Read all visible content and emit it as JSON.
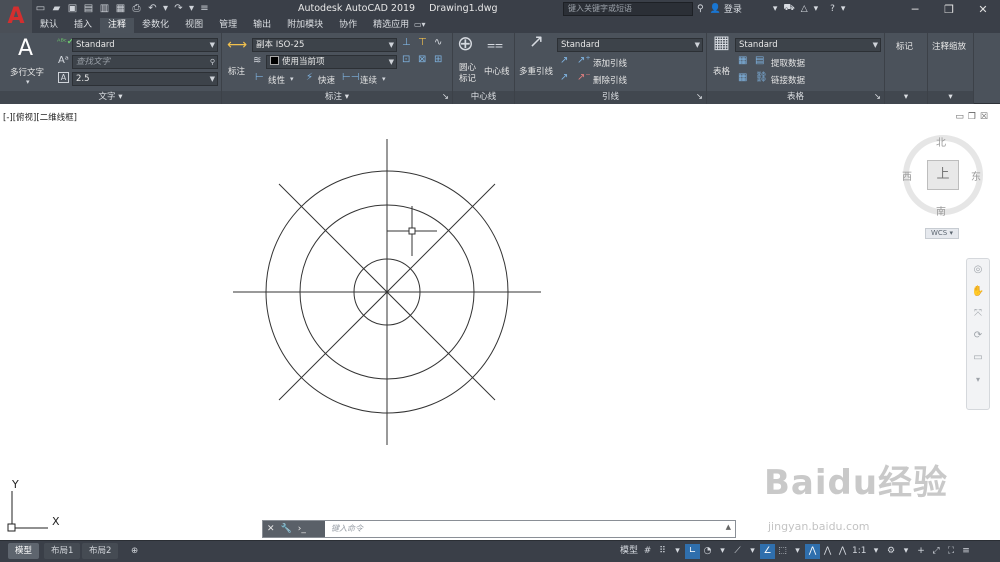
{
  "titlebar": {
    "app_name": "Autodesk AutoCAD 2019",
    "file_name": "Drawing1.dwg",
    "search_placeholder": "键入关键字或短语",
    "login_label": "登录",
    "help_label": "?"
  },
  "tabs": [
    "默认",
    "插入",
    "注释",
    "参数化",
    "视图",
    "管理",
    "输出",
    "附加模块",
    "协作",
    "精选应用"
  ],
  "active_tab": "注释",
  "ribbon": {
    "text_panel": {
      "title": "文字",
      "multiline_text_label": "多行文字",
      "style_value": "Standard",
      "find_placeholder": "查找文字",
      "height_value": "2.5"
    },
    "dimension_panel": {
      "title": "标注",
      "dimension_label": "标注",
      "style_value": "副本 ISO-25",
      "layer_value": "使用当前项",
      "linear_label": "线性",
      "quick_label": "快速",
      "continue_label": "连续"
    },
    "centerline_panel": {
      "title": "中心线",
      "center_mark_label": "圆心\n标记",
      "center_mark_line1": "圆心",
      "center_mark_line2": "标记",
      "centerline_label": "中心线"
    },
    "leader_panel": {
      "title": "引线",
      "multileader_label": "多重引线",
      "style_value": "Standard",
      "add_leader_label": "添加引线",
      "remove_leader_label": "删除引线"
    },
    "table_panel": {
      "title": "表格",
      "table_label": "表格",
      "style_value": "Standard",
      "extract_data_label": "提取数据",
      "link_data_label": "链接数据"
    },
    "markup_panel": {
      "title": "标记"
    },
    "annotation_scaling_panel": {
      "title": "注释缩放"
    }
  },
  "viewport": {
    "label": "[-][俯视][二维线框]"
  },
  "viewcube": {
    "north": "北",
    "south": "南",
    "east": "东",
    "west": "西",
    "face": "上",
    "wcs_label": "WCS"
  },
  "ucs": {
    "x_label": "X",
    "y_label": "Y"
  },
  "command_line": {
    "placeholder": "键入命令"
  },
  "watermark": {
    "text": "Baidu经验",
    "url": "jingyan.baidu.com"
  },
  "layout_tabs": [
    "模型",
    "布局1",
    "布局2"
  ],
  "active_layout": "模型",
  "statusbar": {
    "model_label": "模型",
    "scale_label": "1:1"
  },
  "colors": {
    "title_bg": "#3a3f48",
    "ribbon_bg": "#4b525b",
    "app_logo_red": "#d32f2f",
    "toggle_on_blue": "#2f6fad",
    "drawing_line": "#333333"
  }
}
